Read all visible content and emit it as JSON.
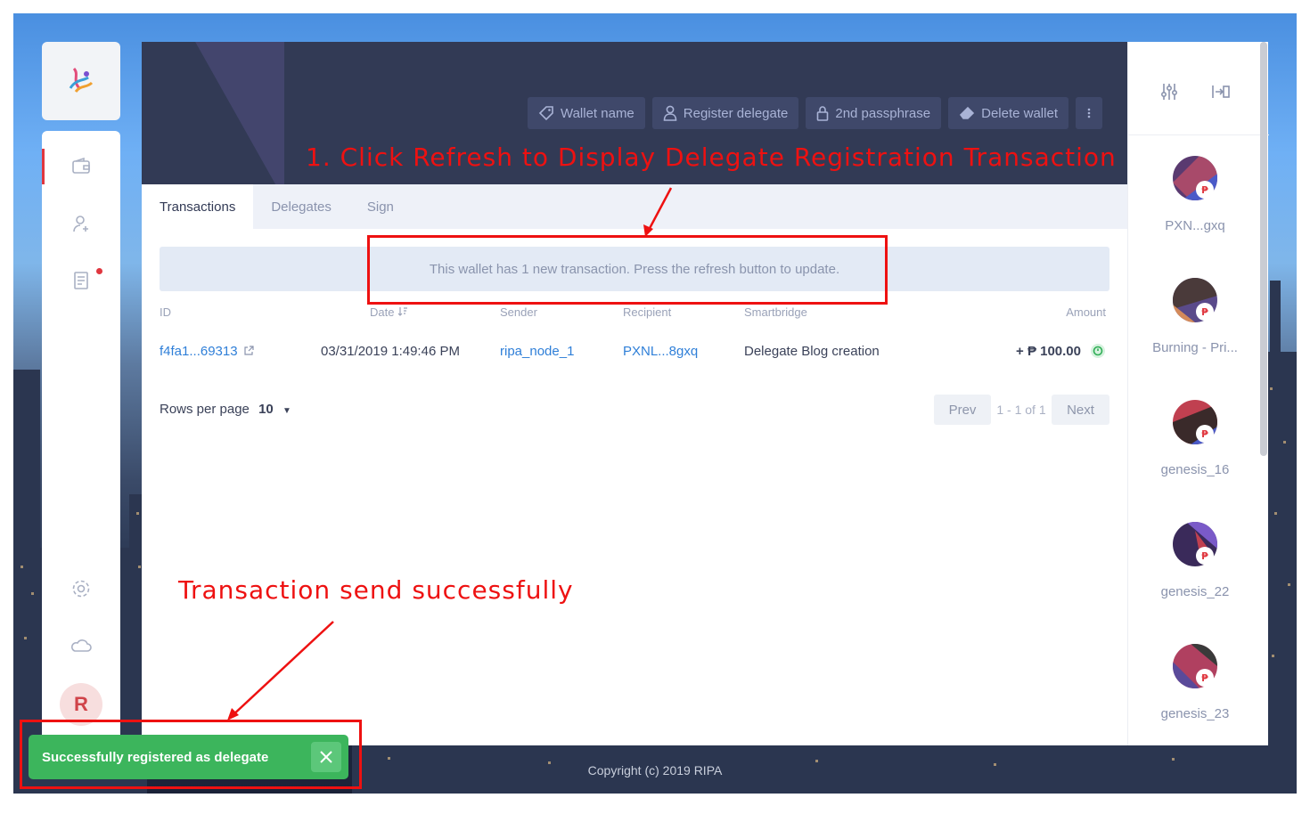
{
  "header": {
    "actions": [
      {
        "label": "Wallet name",
        "icon": "tag-icon"
      },
      {
        "label": "Register delegate",
        "icon": "user-icon"
      },
      {
        "label": "2nd passphrase",
        "icon": "lock-icon"
      },
      {
        "label": "Delete wallet",
        "icon": "eraser-icon"
      }
    ]
  },
  "tabs": [
    {
      "label": "Transactions",
      "active": true
    },
    {
      "label": "Delegates",
      "active": false
    },
    {
      "label": "Sign",
      "active": false
    }
  ],
  "banner": "This wallet has 1 new transaction. Press the refresh button to update.",
  "table": {
    "columns": [
      "ID",
      "Date",
      "Sender",
      "Recipient",
      "Smartbridge",
      "Amount"
    ],
    "rows": [
      {
        "id": "f4fa1...69313",
        "date": "03/31/2019 1:49:46 PM",
        "sender": "ripa_node_1",
        "recipient": "PXNL...8gxq",
        "smartbridge": "Delegate Blog creation",
        "amount": "+ ₱ 100.00"
      }
    ]
  },
  "pagination": {
    "rows_per_page_label": "Rows per page",
    "rows_per_page_value": "10",
    "prev": "Prev",
    "range": "1 - 1 of 1",
    "next": "Next"
  },
  "sidebar": {
    "user_initial": "R"
  },
  "wallets": [
    {
      "name": "PXN...gxq"
    },
    {
      "name": "Burning - Pri..."
    },
    {
      "name": "genesis_16"
    },
    {
      "name": "genesis_22"
    },
    {
      "name": "genesis_23"
    }
  ],
  "footer": {
    "copyright": "Copyright (c) 2019 RIPA"
  },
  "toast": {
    "message": "Successfully registered as delegate"
  },
  "annotations": {
    "refresh": "1. Click Refresh to Display Delegate Registration Transaction",
    "success": "Transaction send successfully"
  },
  "colors": {
    "accent": "#e0373f",
    "header_bg": "#323a55",
    "link": "#2f7fd8",
    "success": "#3cb55c",
    "annotation": "#ee1111"
  }
}
